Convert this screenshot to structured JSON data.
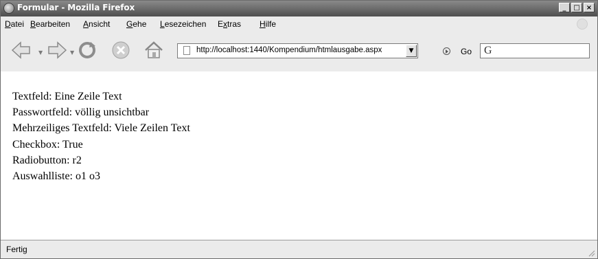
{
  "window": {
    "title": "Formular - Mozilla Firefox",
    "controls": {
      "minimize": "_",
      "maximize": "□",
      "close": "×"
    }
  },
  "menubar": {
    "items": [
      {
        "pre": "",
        "key": "D",
        "post": "atei"
      },
      {
        "pre": "",
        "key": "B",
        "post": "earbeiten"
      },
      {
        "pre": "",
        "key": "A",
        "post": "nsicht"
      },
      {
        "pre": "",
        "key": "G",
        "post": "ehe"
      },
      {
        "pre": "",
        "key": "L",
        "post": "esezeichen"
      },
      {
        "pre": "E",
        "key": "x",
        "post": "tras"
      },
      {
        "pre": "",
        "key": "H",
        "post": "ilfe"
      }
    ]
  },
  "navigation": {
    "url": "http://localhost:1440/Kompendium/htmlausgabe.aspx",
    "go_label": "Go",
    "icons": [
      "back-arrow-icon",
      "forward-arrow-icon",
      "reload-icon",
      "stop-icon",
      "home-icon",
      "page-icon",
      "go-icon",
      "search-engine-icon"
    ]
  },
  "content": {
    "lines": [
      "Textfeld: Eine Zeile Text",
      "Passwortfeld: völlig unsichtbar",
      "Mehrzeiliges Textfeld: Viele Zeilen Text",
      "Checkbox: True",
      "Radiobutton: r2",
      "Auswahlliste: o1 o3"
    ]
  },
  "statusbar": {
    "text": "Fertig"
  }
}
